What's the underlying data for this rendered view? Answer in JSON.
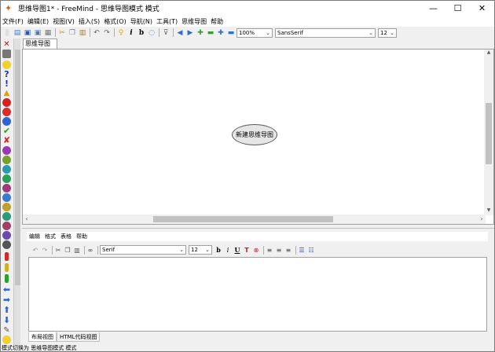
{
  "window": {
    "title": "思维导图1* - FreeMind - 思维导图模式 模式",
    "minimize": "—",
    "maximize": "☐",
    "close": "✕"
  },
  "menubar": [
    "文件(F)",
    "编辑(E)",
    "视图(V)",
    "插入(S)",
    "格式(O)",
    "导航(N)",
    "工具(T)",
    "思维导图",
    "帮助"
  ],
  "toolbar": {
    "zoom": "100%",
    "font_family": "SansSerif",
    "font_size": "12"
  },
  "tabs": [
    "思维导图1*"
  ],
  "map": {
    "root_node": "新建思维导图"
  },
  "editor": {
    "menu": [
      "编辑",
      "格式",
      "表格",
      "帮助"
    ],
    "font_family": "Serif",
    "font_size": "12",
    "bold": "b",
    "italic": "i",
    "underline": "U",
    "tabs": [
      "布局视图",
      "HTML代码视图"
    ]
  },
  "status": "模式切换为 思维导图模式 模式",
  "colors": {
    "node_fill": "#e6e6e6",
    "node_border": "#5a5a5a"
  }
}
